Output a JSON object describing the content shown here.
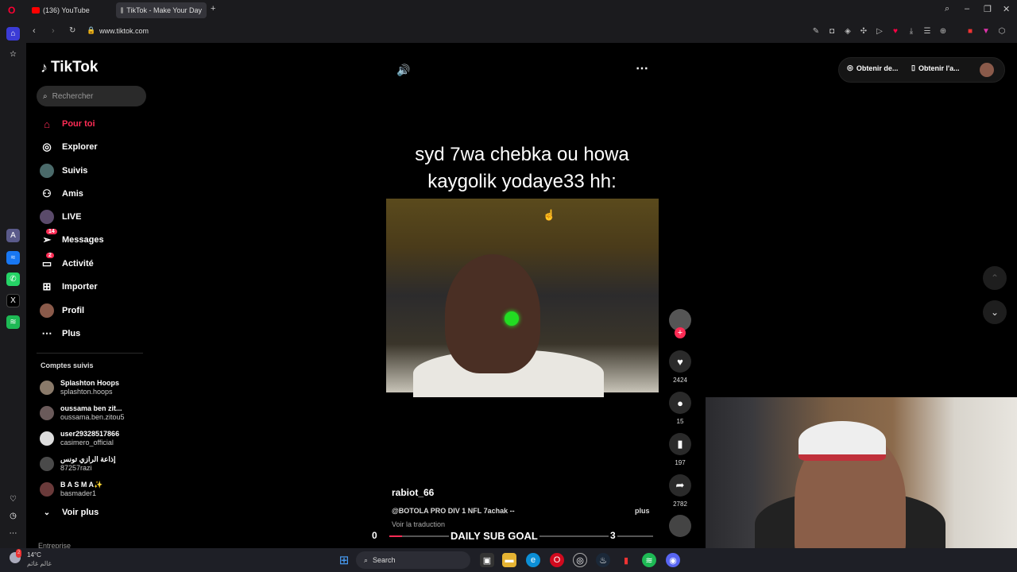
{
  "browser": {
    "tabs": [
      {
        "label": "(136) YouTube",
        "color": "#ff0000"
      },
      {
        "label": "TikTok - Make Your Day",
        "color": "#888888"
      }
    ],
    "new_tab": "+",
    "url": "www.tiktok.com",
    "window_controls": [
      "search-icon",
      "minimize-icon",
      "restore-icon",
      "close-icon"
    ]
  },
  "tiktok": {
    "logo": "TikTok",
    "search_placeholder": "Rechercher",
    "nav": [
      {
        "label": "Pour toi",
        "icon": "home-icon",
        "active": true
      },
      {
        "label": "Explorer",
        "icon": "compass-icon"
      },
      {
        "label": "Suivis",
        "icon": "following-icon"
      },
      {
        "label": "Amis",
        "icon": "friends-icon"
      },
      {
        "label": "LIVE",
        "icon": "live-icon"
      },
      {
        "label": "Messages",
        "icon": "messages-icon",
        "badge": "14"
      },
      {
        "label": "Activité",
        "icon": "activity-icon",
        "badge": "2"
      },
      {
        "label": "Importer",
        "icon": "upload-icon"
      },
      {
        "label": "Profil",
        "icon": "profile-icon"
      },
      {
        "label": "Plus",
        "icon": "more-icon"
      }
    ],
    "following_title": "Comptes suivis",
    "following": [
      {
        "name": "Splashton Hoops",
        "handle": "splashton.hoops"
      },
      {
        "name": "oussama ben zit...",
        "handle": "oussama.ben.zitou5"
      },
      {
        "name": "user29328517866",
        "handle": "casimero_official"
      },
      {
        "name": "إذاعة الرازي تونس",
        "handle": "87257razi"
      },
      {
        "name": "B A S M A✨",
        "handle": "basmader1"
      }
    ],
    "see_more": "Voir plus",
    "cut_off": "Entreprise",
    "top_right": {
      "get_desktop": "Obtenir de...",
      "get_app": "Obtenir l'a..."
    },
    "video": {
      "caption": "syd 7wa chebka ou howa kaygolik yodaye33 hh:",
      "username": "rabiot_66",
      "description": "@BOTOLA PRO DIV 1 NFL 7achak --",
      "more": "plus",
      "translate": "Voir la traduction",
      "likes": "2424",
      "comments": "15",
      "saves": "197",
      "shares": "2782"
    },
    "sub_goal": {
      "label": "DAILY SUB GOAL",
      "current": "0",
      "target": "3"
    }
  },
  "taskbar": {
    "weather_temp": "14°C",
    "weather_loc": "غالم غائم",
    "weather_badge": "2",
    "search": "Search"
  }
}
